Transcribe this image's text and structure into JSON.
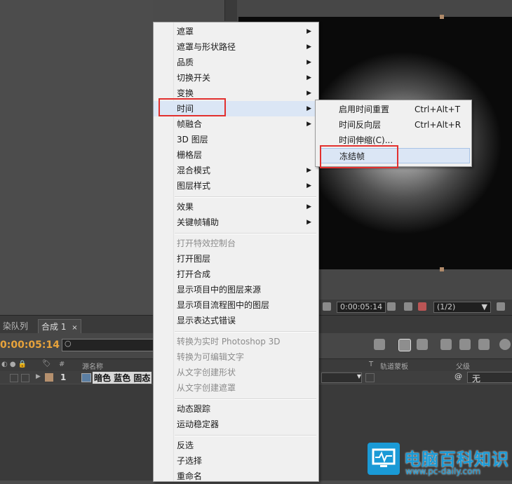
{
  "context_menu": {
    "items": [
      {
        "label": "遮罩",
        "submenu": true,
        "disabled": false
      },
      {
        "label": "遮罩与形状路径",
        "submenu": true,
        "disabled": false
      },
      {
        "label": "品质",
        "submenu": true,
        "disabled": false
      },
      {
        "label": "切换开关",
        "submenu": true,
        "disabled": false
      },
      {
        "label": "变换",
        "submenu": true,
        "disabled": false
      },
      {
        "label": "时间",
        "submenu": true,
        "disabled": false,
        "highlighted": true
      },
      {
        "label": "帧融合",
        "submenu": true,
        "disabled": false
      },
      {
        "label": "3D 图层",
        "submenu": false,
        "disabled": false
      },
      {
        "label": "栅格层",
        "submenu": false,
        "disabled": false
      },
      {
        "label": "混合模式",
        "submenu": true,
        "disabled": false
      },
      {
        "label": "图层样式",
        "submenu": true,
        "disabled": false
      },
      {
        "label": "效果",
        "submenu": true,
        "disabled": false
      },
      {
        "label": "关键帧辅助",
        "submenu": true,
        "disabled": false
      },
      {
        "label": "打开特效控制台",
        "submenu": false,
        "disabled": true
      },
      {
        "label": "打开图层",
        "submenu": false,
        "disabled": false
      },
      {
        "label": "打开合成",
        "submenu": false,
        "disabled": false
      },
      {
        "label": "显示项目中的图层来源",
        "submenu": false,
        "disabled": false
      },
      {
        "label": "显示项目流程图中的图层",
        "submenu": false,
        "disabled": false
      },
      {
        "label": "显示表达式错误",
        "submenu": false,
        "disabled": false
      },
      {
        "label": "转换为实时 Photoshop 3D",
        "submenu": false,
        "disabled": true
      },
      {
        "label": "转换为可编辑文字",
        "submenu": false,
        "disabled": true
      },
      {
        "label": "从文字创建形状",
        "submenu": false,
        "disabled": true
      },
      {
        "label": "从文字创建遮罩",
        "submenu": false,
        "disabled": true
      },
      {
        "label": "动态跟踪",
        "submenu": false,
        "disabled": false
      },
      {
        "label": "运动稳定器",
        "submenu": false,
        "disabled": false
      },
      {
        "label": "反选",
        "submenu": false,
        "disabled": false
      },
      {
        "label": "子选择",
        "submenu": false,
        "disabled": false
      },
      {
        "label": "重命名",
        "submenu": false,
        "disabled": false
      }
    ]
  },
  "time_submenu": {
    "items": [
      {
        "label": "启用时间重置",
        "shortcut": "Ctrl+Alt+T"
      },
      {
        "label": "时间反向层",
        "shortcut": "Ctrl+Alt+R"
      },
      {
        "label": "时间伸缩(C)...",
        "shortcut": ""
      },
      {
        "label": "冻结帧",
        "shortcut": "",
        "highlighted": true
      }
    ]
  },
  "viewer": {
    "timecode": "0:00:05:14",
    "resolution": "(1/2)"
  },
  "timeline": {
    "tab_render_queue": "染队列",
    "tab_comp": "合成 1",
    "timecode": "0:00:05:14",
    "col_number": "#",
    "col_source_name": "源名称",
    "col_t": "T",
    "col_track_matte": "轨道蒙板",
    "col_parent": "父级",
    "layer_index": "1",
    "layer_name": "暗色 蓝色 固态",
    "layer_parent": "无"
  },
  "watermark": {
    "title": "电脑百科知识",
    "url": "www.pc-daily.com"
  },
  "colors": {
    "timecode_orange": "#e8a33b",
    "highlight_box_red": "#e2302e",
    "watermark_blue": "#1a9ad6"
  }
}
